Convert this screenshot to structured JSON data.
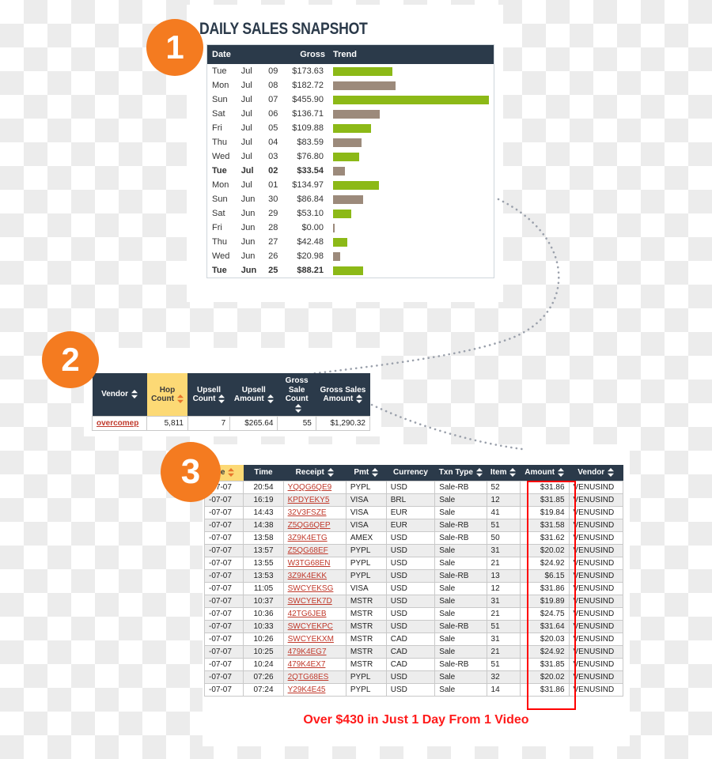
{
  "steps": [
    {
      "number": "1"
    },
    {
      "number": "2"
    },
    {
      "number": "3"
    }
  ],
  "colors": {
    "accent_orange": "#F47B20",
    "header_dark": "#2B3A4A",
    "highlight_yellow": "#FCD975",
    "bar_green": "#8CB917",
    "bar_brown": "#9C8A7B",
    "link_red": "#C0392B",
    "caption_red": "#FF1A1A",
    "outline_red": "#FF0000"
  },
  "snapshot": {
    "title": "DAILY SALES SNAPSHOT",
    "columns": [
      "Date",
      "Gross",
      "Trend"
    ],
    "max_gross": 455.9,
    "rows": [
      {
        "day": "Tue",
        "month": "Jul",
        "date": "09",
        "gross": "$173.63",
        "value": 173.63,
        "color": "green",
        "bold": false
      },
      {
        "day": "Mon",
        "month": "Jul",
        "date": "08",
        "gross": "$182.72",
        "value": 182.72,
        "color": "brown",
        "bold": false
      },
      {
        "day": "Sun",
        "month": "Jul",
        "date": "07",
        "gross": "$455.90",
        "value": 455.9,
        "color": "green",
        "bold": false
      },
      {
        "day": "Sat",
        "month": "Jul",
        "date": "06",
        "gross": "$136.71",
        "value": 136.71,
        "color": "brown",
        "bold": false
      },
      {
        "day": "Fri",
        "month": "Jul",
        "date": "05",
        "gross": "$109.88",
        "value": 109.88,
        "color": "green",
        "bold": false
      },
      {
        "day": "Thu",
        "month": "Jul",
        "date": "04",
        "gross": "$83.59",
        "value": 83.59,
        "color": "brown",
        "bold": false
      },
      {
        "day": "Wed",
        "month": "Jul",
        "date": "03",
        "gross": "$76.80",
        "value": 76.8,
        "color": "green",
        "bold": false
      },
      {
        "day": "Tue",
        "month": "Jul",
        "date": "02",
        "gross": "$33.54",
        "value": 33.54,
        "color": "brown",
        "bold": true
      },
      {
        "day": "Mon",
        "month": "Jul",
        "date": "01",
        "gross": "$134.97",
        "value": 134.97,
        "color": "green",
        "bold": false
      },
      {
        "day": "Sun",
        "month": "Jun",
        "date": "30",
        "gross": "$86.84",
        "value": 86.84,
        "color": "brown",
        "bold": false
      },
      {
        "day": "Sat",
        "month": "Jun",
        "date": "29",
        "gross": "$53.10",
        "value": 53.1,
        "color": "green",
        "bold": false
      },
      {
        "day": "Fri",
        "month": "Jun",
        "date": "28",
        "gross": "$0.00",
        "value": 0.0,
        "color": "brown",
        "bold": false
      },
      {
        "day": "Thu",
        "month": "Jun",
        "date": "27",
        "gross": "$42.48",
        "value": 42.48,
        "color": "green",
        "bold": false
      },
      {
        "day": "Wed",
        "month": "Jun",
        "date": "26",
        "gross": "$20.98",
        "value": 20.98,
        "color": "brown",
        "bold": false
      },
      {
        "day": "Tue",
        "month": "Jun",
        "date": "25",
        "gross": "$88.21",
        "value": 88.21,
        "color": "green",
        "bold": true
      }
    ]
  },
  "hop_table": {
    "columns": [
      {
        "label": "Vendor",
        "sortable": true,
        "highlight": false
      },
      {
        "label": "Hop\nCount",
        "sortable": true,
        "highlight": true
      },
      {
        "label": "Upsell\nCount",
        "sortable": true,
        "highlight": false
      },
      {
        "label": "Upsell\nAmount",
        "sortable": true,
        "highlight": false
      },
      {
        "label": "Gross\nSale\nCount",
        "sortable": true,
        "highlight": false
      },
      {
        "label": "Gross Sales\nAmount",
        "sortable": true,
        "highlight": false
      }
    ],
    "rows": [
      {
        "vendor": "overcomep",
        "hop_count": "5,811",
        "upsell_count": "7",
        "upsell_amount": "$265.64",
        "gross_sale_count": "55",
        "gross_sales_amount": "$1,290.32"
      }
    ]
  },
  "txn_table": {
    "columns": [
      {
        "label": "ate",
        "sortable": true,
        "highlight": true
      },
      {
        "label": "Time",
        "sortable": false,
        "highlight": false
      },
      {
        "label": "Receipt",
        "sortable": true,
        "highlight": false
      },
      {
        "label": "Pmt",
        "sortable": true,
        "highlight": false
      },
      {
        "label": "Currency",
        "sortable": false,
        "highlight": false
      },
      {
        "label": "Txn Type",
        "sortable": true,
        "highlight": false
      },
      {
        "label": "Item",
        "sortable": true,
        "highlight": false
      },
      {
        "label": "Amount",
        "sortable": true,
        "highlight": false
      },
      {
        "label": "Vendor",
        "sortable": true,
        "highlight": false
      }
    ],
    "rows": [
      {
        "date": "-07-07",
        "time": "20:54",
        "receipt": "YQQG6QE9",
        "pmt": "PYPL",
        "currency": "USD",
        "txn_type": "Sale-RB",
        "item": "52",
        "amount": "$31.86",
        "vendor": "VENUSIND"
      },
      {
        "date": "-07-07",
        "time": "16:19",
        "receipt": "KPDYEKY5",
        "pmt": "VISA",
        "currency": "BRL",
        "txn_type": "Sale",
        "item": "12",
        "amount": "$31.85",
        "vendor": "VENUSIND"
      },
      {
        "date": "-07-07",
        "time": "14:43",
        "receipt": "32V3FSZE",
        "pmt": "VISA",
        "currency": "EUR",
        "txn_type": "Sale",
        "item": "41",
        "amount": "$19.84",
        "vendor": "VENUSIND"
      },
      {
        "date": "-07-07",
        "time": "14:38",
        "receipt": "Z5QG6QEP",
        "pmt": "VISA",
        "currency": "EUR",
        "txn_type": "Sale-RB",
        "item": "51",
        "amount": "$31.58",
        "vendor": "VENUSIND"
      },
      {
        "date": "-07-07",
        "time": "13:58",
        "receipt": "3Z9K4ETG",
        "pmt": "AMEX",
        "currency": "USD",
        "txn_type": "Sale-RB",
        "item": "50",
        "amount": "$31.62",
        "vendor": "VENUSIND"
      },
      {
        "date": "-07-07",
        "time": "13:57",
        "receipt": "Z5QG68EF",
        "pmt": "PYPL",
        "currency": "USD",
        "txn_type": "Sale",
        "item": "31",
        "amount": "$20.02",
        "vendor": "VENUSIND"
      },
      {
        "date": "-07-07",
        "time": "13:55",
        "receipt": "W3TG68EN",
        "pmt": "PYPL",
        "currency": "USD",
        "txn_type": "Sale",
        "item": "21",
        "amount": "$24.92",
        "vendor": "VENUSIND"
      },
      {
        "date": "-07-07",
        "time": "13:53",
        "receipt": "3Z9K4EKK",
        "pmt": "PYPL",
        "currency": "USD",
        "txn_type": "Sale-RB",
        "item": "13",
        "amount": "$6.15",
        "vendor": "VENUSIND"
      },
      {
        "date": "-07-07",
        "time": "11:05",
        "receipt": "SWCYEKSG",
        "pmt": "VISA",
        "currency": "USD",
        "txn_type": "Sale",
        "item": "12",
        "amount": "$31.86",
        "vendor": "VENUSIND"
      },
      {
        "date": "-07-07",
        "time": "10:37",
        "receipt": "SWCYEK7D",
        "pmt": "MSTR",
        "currency": "USD",
        "txn_type": "Sale",
        "item": "31",
        "amount": "$19.89",
        "vendor": "VENUSIND"
      },
      {
        "date": "-07-07",
        "time": "10:36",
        "receipt": "42TG6JEB",
        "pmt": "MSTR",
        "currency": "USD",
        "txn_type": "Sale",
        "item": "21",
        "amount": "$24.75",
        "vendor": "VENUSIND"
      },
      {
        "date": "-07-07",
        "time": "10:33",
        "receipt": "SWCYEKPC",
        "pmt": "MSTR",
        "currency": "USD",
        "txn_type": "Sale-RB",
        "item": "51",
        "amount": "$31.64",
        "vendor": "VENUSIND"
      },
      {
        "date": "-07-07",
        "time": "10:26",
        "receipt": "SWCYEKXM",
        "pmt": "MSTR",
        "currency": "CAD",
        "txn_type": "Sale",
        "item": "31",
        "amount": "$20.03",
        "vendor": "VENUSIND"
      },
      {
        "date": "-07-07",
        "time": "10:25",
        "receipt": "479K4EG7",
        "pmt": "MSTR",
        "currency": "CAD",
        "txn_type": "Sale",
        "item": "21",
        "amount": "$24.92",
        "vendor": "VENUSIND"
      },
      {
        "date": "-07-07",
        "time": "10:24",
        "receipt": "479K4EX7",
        "pmt": "MSTR",
        "currency": "CAD",
        "txn_type": "Sale-RB",
        "item": "51",
        "amount": "$31.85",
        "vendor": "VENUSIND"
      },
      {
        "date": "-07-07",
        "time": "07:26",
        "receipt": "2QTG68ES",
        "pmt": "PYPL",
        "currency": "USD",
        "txn_type": "Sale",
        "item": "32",
        "amount": "$20.02",
        "vendor": "VENUSIND"
      },
      {
        "date": "-07-07",
        "time": "07:24",
        "receipt": "Y29K4E45",
        "pmt": "PYPL",
        "currency": "USD",
        "txn_type": "Sale",
        "item": "14",
        "amount": "$31.86",
        "vendor": "VENUSIND"
      }
    ]
  },
  "caption": "Over $430 in Just 1 Day From 1 Video",
  "chart_data": {
    "type": "bar",
    "title": "DAILY SALES SNAPSHOT",
    "xlabel": "Gross",
    "ylabel": "Date",
    "orientation": "horizontal",
    "categories": [
      "Tue Jul 09",
      "Mon Jul 08",
      "Sun Jul 07",
      "Sat Jul 06",
      "Fri Jul 05",
      "Thu Jul 04",
      "Wed Jul 03",
      "Tue Jul 02",
      "Mon Jul 01",
      "Sun Jun 30",
      "Sat Jun 29",
      "Fri Jun 28",
      "Thu Jun 27",
      "Wed Jun 26",
      "Tue Jun 25"
    ],
    "values": [
      173.63,
      182.72,
      455.9,
      136.71,
      109.88,
      83.59,
      76.8,
      33.54,
      134.97,
      86.84,
      53.1,
      0.0,
      42.48,
      20.98,
      88.21
    ],
    "bar_colors": [
      "green",
      "brown",
      "green",
      "brown",
      "green",
      "brown",
      "green",
      "brown",
      "green",
      "brown",
      "green",
      "brown",
      "green",
      "brown",
      "green"
    ],
    "xlim": [
      0,
      455.9
    ],
    "grid": false,
    "legend": "none"
  }
}
